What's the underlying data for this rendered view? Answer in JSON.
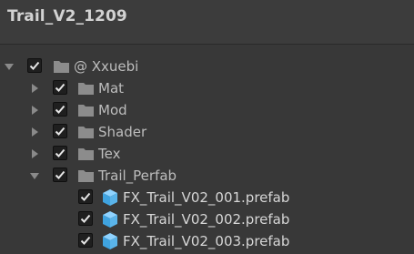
{
  "window": {
    "title": "Trail_V2_1209"
  },
  "tree": {
    "root": {
      "label": "@ Xxuebi",
      "expanded": true,
      "checked": true,
      "icon": "folder-icon"
    },
    "folders": [
      {
        "label": "Mat",
        "expanded": false,
        "checked": true,
        "icon": "folder-icon"
      },
      {
        "label": "Mod",
        "expanded": false,
        "checked": true,
        "icon": "folder-icon"
      },
      {
        "label": "Shader",
        "expanded": false,
        "checked": true,
        "icon": "folder-icon"
      },
      {
        "label": "Tex",
        "expanded": false,
        "checked": true,
        "icon": "folder-icon"
      },
      {
        "label": "Trail_Perfab",
        "expanded": true,
        "checked": true,
        "icon": "folder-icon"
      }
    ],
    "files": [
      {
        "label": "FX_Trail_V02_001.prefab",
        "checked": true,
        "icon": "prefab-cube-icon"
      },
      {
        "label": "FX_Trail_V02_002.prefab",
        "checked": true,
        "icon": "prefab-cube-icon"
      },
      {
        "label": "FX_Trail_V02_003.prefab",
        "checked": true,
        "icon": "prefab-cube-icon"
      }
    ]
  },
  "colors": {
    "background": "#383838",
    "header": "#3c3c3c",
    "folder": "#8c8c8c",
    "prefab": "#5ab4ea"
  }
}
